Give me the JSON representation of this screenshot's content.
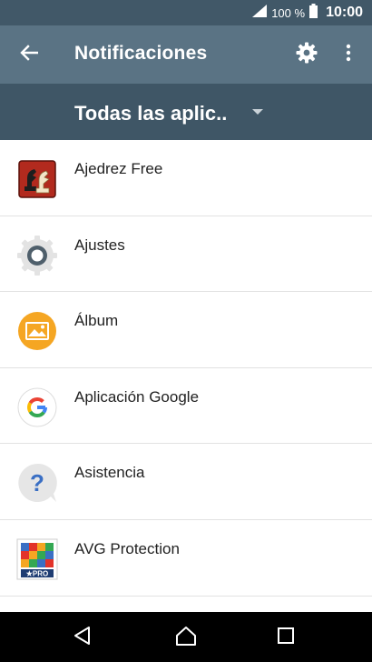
{
  "status_bar": {
    "battery_percent": "100 %",
    "time": "10:00",
    "icons": [
      "signal-icon",
      "battery-icon"
    ]
  },
  "app_bar": {
    "title": "Notificaciones",
    "back_icon": "arrow-left-icon",
    "settings_icon": "gear-icon",
    "more_icon": "more-vertical-icon"
  },
  "filter": {
    "selected": "Todas las aplic..",
    "icon": "caret-down-icon"
  },
  "apps": [
    {
      "name": "Ajedrez Free",
      "icon": "chess-icon"
    },
    {
      "name": "Ajustes",
      "icon": "settings-app-icon"
    },
    {
      "name": "Álbum",
      "icon": "album-icon"
    },
    {
      "name": "Aplicación Google",
      "icon": "google-icon"
    },
    {
      "name": "Asistencia",
      "icon": "help-icon"
    },
    {
      "name": "AVG Protection",
      "icon": "avg-icon"
    }
  ],
  "avg_badge": "★PRO",
  "nav_bar": {
    "icons": [
      "back-triangle-icon",
      "home-icon",
      "recents-icon"
    ]
  },
  "colors": {
    "status_bar": "#415868",
    "app_bar": "#5a7384",
    "filter_bar": "#3f5666",
    "nav_bar": "#000000"
  }
}
